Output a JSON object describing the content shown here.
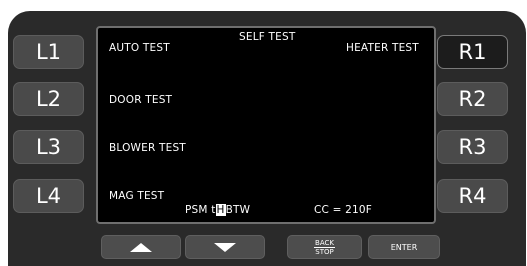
{
  "left_keys": [
    "L1",
    "L2",
    "L3",
    "L4"
  ],
  "right_keys": [
    "R1",
    "R2",
    "R3",
    "R4"
  ],
  "screen": {
    "title": "SELF TEST",
    "auto_test": "AUTO TEST",
    "heater_test": "HEATER TEST",
    "door_test": "DOOR TEST",
    "blower_test": "BLOWER TEST",
    "mag_test": "MAG TEST",
    "status_prefix": "PSM t",
    "status_cursor": "H",
    "status_suffix": "BTW",
    "cc_readout": "CC =  210F"
  },
  "buttons": {
    "up_icon": "up-arrow-icon",
    "down_icon": "down-arrow-icon",
    "back_top": "BACK",
    "back_bottom": "STOP",
    "enter": "ENTER"
  },
  "colors": {
    "panel": "#2a2a2a",
    "key": "#4a4a4a",
    "key_selected": "#1c1c1c",
    "screen": "#000000",
    "text": "#ffffff"
  }
}
